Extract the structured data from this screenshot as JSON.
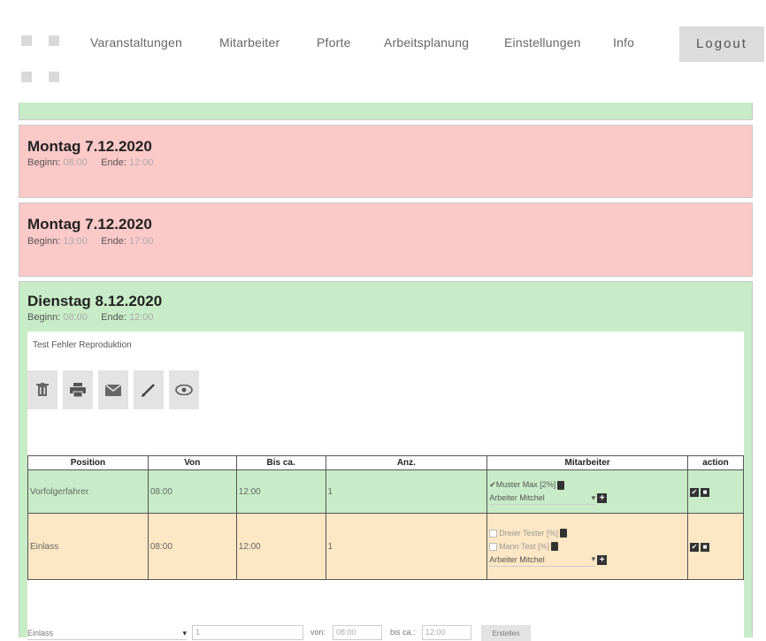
{
  "nav": {
    "items": [
      "Varanstaltungen",
      "Mitarbeiter",
      "Pforte",
      "Arbeitsplanung",
      "Einstellungen",
      "Info"
    ],
    "logout": "Logout"
  },
  "days": [
    {
      "title": "Montag 7.12.2020",
      "begin_label": "Beginn:",
      "begin": "08:00",
      "end_label": "Ende:",
      "end": "12:00"
    },
    {
      "title": "Montag 7.12.2020",
      "begin_label": "Beginn:",
      "begin": "13:00",
      "end_label": "Ende:",
      "end": "17:00"
    },
    {
      "title": "Dienstag 8.12.2020",
      "begin_label": "Beginn:",
      "begin": "08:00",
      "end_label": "Ende:",
      "end": "12:00"
    }
  ],
  "detail": {
    "note": "Test Fehler Reproduktion",
    "icons": [
      "trash-icon",
      "print-icon",
      "mail-icon",
      "edit-icon",
      "eye-icon"
    ]
  },
  "table": {
    "headers": [
      "Position",
      "Von",
      "Bis ca.",
      "Anz.",
      "Mitarbeiter",
      "action"
    ],
    "rows": [
      {
        "position": "Vorfolgerfahrer",
        "von": "08:00",
        "bis": "12:00",
        "anz": "1",
        "workers": [
          {
            "name": "✔Muster Max [2%]",
            "checked": true
          }
        ],
        "select": "Arbeiter Mitchel"
      },
      {
        "position": "Einlass",
        "von": "08:00",
        "bis": "12:00",
        "anz": "1",
        "workers": [
          {
            "name": "Dreier Tester [%]",
            "checked": false
          },
          {
            "name": "Mann Test [%]",
            "checked": false
          }
        ],
        "select": "Arbeiter Mitchel"
      }
    ]
  },
  "addrow": {
    "select": "Einlass",
    "count": "1",
    "von_label": "von:",
    "von": "08:00",
    "bis_label": "bis ca.:",
    "bis": "12:00",
    "button": "Erstellen"
  },
  "colors": {
    "red_card": "#fcc9c9",
    "green_card": "#c8ecc8",
    "orange_row": "#fde7c4"
  }
}
